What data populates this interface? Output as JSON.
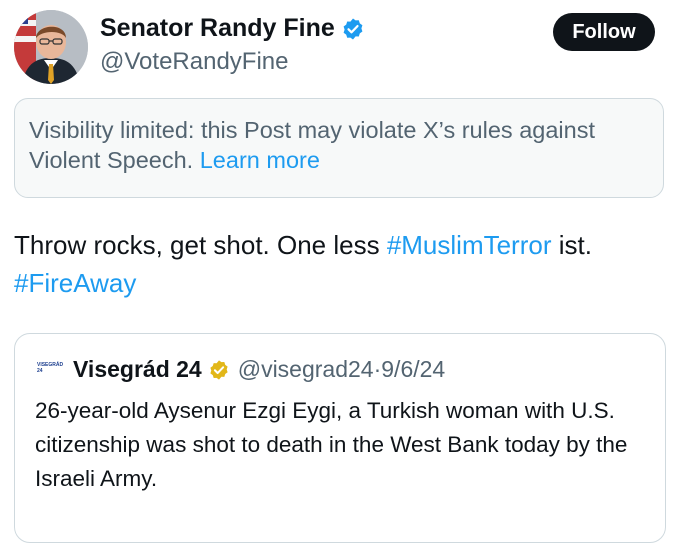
{
  "author": {
    "name": "Senator Randy Fine",
    "handle": "@VoteRandyFine",
    "verified_color": "#1d9bf0"
  },
  "follow_label": "Follow",
  "notice": {
    "text": "Visibility limited: this Post may violate X’s rules against Violent Speech.",
    "link": "Learn more"
  },
  "tweet": {
    "segments": [
      {
        "text": "Throw rocks, get shot.  One less ",
        "type": "text"
      },
      {
        "text": "#MuslimTerror",
        "type": "hashtag"
      },
      {
        "text": " ist.",
        "type": "text"
      },
      {
        "text": "#FireAway",
        "type": "hashtag"
      }
    ]
  },
  "quote": {
    "avatar_text": "VISEGRÁD 24",
    "name": "Visegrád 24",
    "badge_color": "#e2b719",
    "handle": "@visegrad24",
    "separator": "·",
    "date": "9/6/24",
    "text": "26-year-old Aysenur Ezgi Eygi, a Turkish woman with U.S. citizenship was shot to death in the West Bank today by the Israeli Army."
  },
  "colors": {
    "accent": "#1d9bf0",
    "text": "#0f1419",
    "muted": "#536471"
  }
}
